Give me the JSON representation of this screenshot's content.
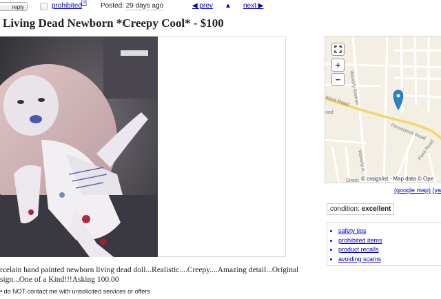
{
  "toolbar": {
    "reply_label": "reply",
    "prohibited_label": "prohibited",
    "prohibited_sup": "[?]",
    "posted_label": "Posted:",
    "posted_value": "29 days ago",
    "prev_label": "◀ prev",
    "up_label": "▲",
    "next_label": "next ▶"
  },
  "listing": {
    "title": "Living Dead Newborn *Creepy Cool* - $100",
    "description": "rcelain hand painted newborn living dead doll...Realistic....Creepy....Amazing detail...Original sign...One of a Kind!!!Asking 100.00",
    "notice": "do NOT contact me with unsolicited services or offers"
  },
  "map": {
    "streets": [
      "Waverly Avenue",
      "block Road",
      "Horseblock Road",
      "Waverly A...",
      "Point Road",
      "oad",
      "Street"
    ],
    "attribution": "© craigslist - Map data © Ope",
    "google_link": "(google map)",
    "yahoo_link": "(ya",
    "colors": {
      "background": "#f4efe4",
      "major_road": "#f6e07a",
      "minor_road": "#ffffff",
      "pin": "#2b82cb"
    }
  },
  "condition": {
    "label": "condition:",
    "value": "excellent"
  },
  "safety_links": [
    "safety tips",
    "prohibited items",
    "product recalls",
    "avoiding scams"
  ],
  "icons": {
    "fullscreen": "fullscreen-icon",
    "zoom_in": "+",
    "zoom_out": "−",
    "pin": "map-pin-icon"
  }
}
